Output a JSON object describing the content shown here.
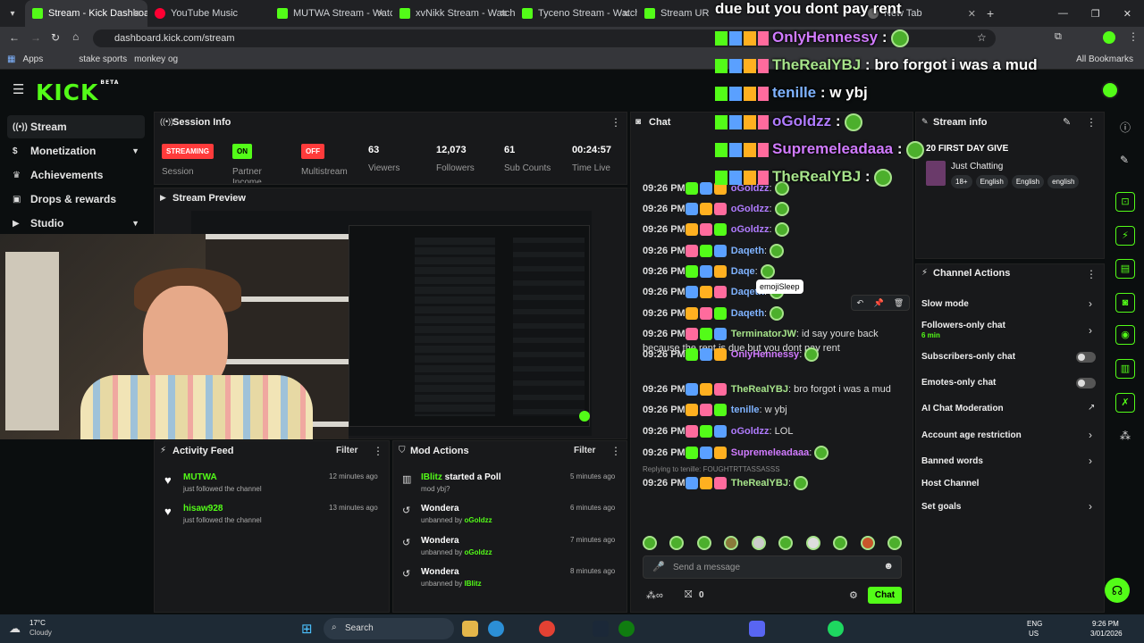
{
  "browser": {
    "tabs": [
      {
        "label": "Stream - Kick Dashboard",
        "active": true,
        "color": "#53fc18"
      },
      {
        "label": "YouTube Music",
        "active": false,
        "color": "#ff0033"
      },
      {
        "label": "MUTWA Stream - Watch L",
        "active": false,
        "color": "#53fc18"
      },
      {
        "label": "xvNikk Stream - Watch Li",
        "active": false,
        "color": "#53fc18"
      },
      {
        "label": "Tyceno Stream - Watch Li",
        "active": false,
        "color": "#53fc18"
      },
      {
        "label": "Stream URL & K",
        "active": false,
        "color": "#53fc18"
      },
      {
        "label": "New Tab",
        "active": false,
        "color": "#888888"
      }
    ],
    "url": "dashboard.kick.com/stream",
    "bookmarks": [
      "Apps",
      "stake sports",
      "monkey og"
    ],
    "all_bookmarks": "All Bookmarks"
  },
  "sidebar": {
    "items": [
      {
        "label": "Stream",
        "icon": "signal-icon"
      },
      {
        "label": "Monetization",
        "icon": "dollar-icon"
      },
      {
        "label": "Achievements",
        "icon": "trophy-icon"
      },
      {
        "label": "Drops & rewards",
        "icon": "gift-icon"
      },
      {
        "label": "Studio",
        "icon": "video-icon"
      }
    ]
  },
  "session": {
    "title": "Session Info",
    "live_badge": "STREAMING",
    "session_label": "Session",
    "partner_badge": "ON",
    "partner_label": "Partner Income",
    "multistream_badge": "OFF",
    "multistream_label": "Multistream",
    "viewers_value": "63",
    "viewers_label": "Viewers",
    "followers_value": "12,073",
    "followers_label": "Followers",
    "subs_value": "61",
    "subs_label": "Sub Counts",
    "time_value": "00:24:57",
    "time_label": "Time Live"
  },
  "preview": {
    "title": "Stream Preview"
  },
  "activity": {
    "title": "Activity Feed",
    "filter": "Filter",
    "items": [
      {
        "name": "MUTWA",
        "desc": "just followed the channel",
        "time": "12 minutes ago"
      },
      {
        "name": "hisaw928",
        "desc": "just followed the channel",
        "time": "13 minutes ago"
      }
    ]
  },
  "mod": {
    "title": "Mod Actions",
    "filter": "Filter",
    "items": [
      {
        "name": "IBlitz",
        "action": "started a Poll",
        "sub": "mod ybj?",
        "by": "",
        "time": "5 minutes ago"
      },
      {
        "name": "Wondera",
        "action": "",
        "sub": "unbanned by ",
        "by": "oGoldzz",
        "time": "6 minutes ago"
      },
      {
        "name": "Wondera",
        "action": "",
        "sub": "unbanned by ",
        "by": "oGoldzz",
        "time": "7 minutes ago"
      },
      {
        "name": "Wondera",
        "action": "",
        "sub": "unbanned by ",
        "by": "IBlitz",
        "time": "8 minutes ago"
      }
    ]
  },
  "chat": {
    "title": "Chat",
    "messages": [
      {
        "time": "09:26 PM",
        "user": "oGoldzz",
        "color": "#b07cff",
        "text": ""
      },
      {
        "time": "09:26 PM",
        "user": "oGoldzz",
        "color": "#b07cff",
        "text": ""
      },
      {
        "time": "09:26 PM",
        "user": "oGoldzz",
        "color": "#b07cff",
        "text": ""
      },
      {
        "time": "09:26 PM",
        "user": "Daqeth",
        "color": "#7fb3ff",
        "text": ""
      },
      {
        "time": "09:26 PM",
        "user": "Daqe",
        "color": "#7fb3ff",
        "text": ""
      },
      {
        "time": "09:26 PM",
        "user": "Daqeth",
        "color": "#7fb3ff",
        "text": ""
      },
      {
        "time": "09:26 PM",
        "user": "Daqeth",
        "color": "#7fb3ff",
        "text": ""
      },
      {
        "time": "09:26 PM",
        "user": "TerminatorJW",
        "color": "#a6e38a",
        "text": "id say youre back because the rent is due but you dont pay rent"
      },
      {
        "time": "09:26 PM",
        "user": "OnlyHennessy",
        "color": "#d17bff",
        "text": ""
      },
      {
        "time": "09:26 PM",
        "user": "TheRealYBJ",
        "color": "#a6e38a",
        "text": "bro forgot i was a mud"
      },
      {
        "time": "09:26 PM",
        "user": "tenille",
        "color": "#7fb3ff",
        "text": "w ybj"
      },
      {
        "time": "09:26 PM",
        "user": "oGoldzz",
        "color": "#b07cff",
        "text": "LOL"
      },
      {
        "time": "09:26 PM",
        "user": "Supremeleadaaa",
        "color": "#d17bff",
        "text": ""
      },
      {
        "time": "09:26 PM",
        "user": "TheRealYBJ",
        "color": "#a6e38a",
        "text": ""
      }
    ],
    "reply_hint": "Replying to tenille: FOUGHTRTTASSASSS",
    "tooltip": "emojiSleep",
    "input_placeholder": "Send a message",
    "count": "0",
    "send_label": "Chat"
  },
  "overlay": [
    {
      "text": "due but you dont pay rent",
      "color": "#ffffff"
    },
    {
      "user": "OnlyHennessy",
      "text": "",
      "color": "#d17bff"
    },
    {
      "user": "TheRealYBJ",
      "text": "bro forgot i was a mud",
      "color": "#a6e38a"
    },
    {
      "user": "tenille",
      "text": "w ybj",
      "color": "#7fb3ff"
    },
    {
      "user": "oGoldzz",
      "text": "",
      "color": "#b07cff"
    },
    {
      "user": "Supremeleadaaa",
      "text": "",
      "color": "#d17bff"
    },
    {
      "user": "TheRealYBJ",
      "text": "",
      "color": "#a6e38a"
    }
  ],
  "stream_info": {
    "title": "Stream info",
    "headline": "20 FIRST DAY GIVE",
    "category": "Just Chatting",
    "tags": [
      "18+",
      "English",
      "English",
      "english"
    ]
  },
  "channel_actions": {
    "title": "Channel Actions",
    "items": [
      {
        "label": "Slow mode",
        "sub": "",
        "control": "arrow"
      },
      {
        "label": "Followers-only chat",
        "sub": "6 min",
        "control": "arrow"
      },
      {
        "label": "Subscribers-only chat",
        "sub": "",
        "control": "toggle"
      },
      {
        "label": "Emotes-only chat",
        "sub": "",
        "control": "toggle"
      },
      {
        "label": "AI Chat Moderation",
        "sub": "",
        "control": "external"
      },
      {
        "label": "Account age restriction",
        "sub": "",
        "control": "arrow"
      },
      {
        "label": "Banned words",
        "sub": "",
        "control": "arrow"
      },
      {
        "label": "Host Channel",
        "sub": "",
        "control": "none"
      },
      {
        "label": "Set goals",
        "sub": "",
        "control": "arrow"
      }
    ]
  },
  "taskbar": {
    "weather_temp": "17°C",
    "weather_desc": "Cloudy",
    "search": "Search",
    "lang1": "ENG",
    "lang2": "US",
    "time": "9:26 PM",
    "date": "3/01/2026"
  },
  "colors": {
    "accent": "#53fc18",
    "live": "#ff3b3b",
    "panel": "#18191b"
  }
}
